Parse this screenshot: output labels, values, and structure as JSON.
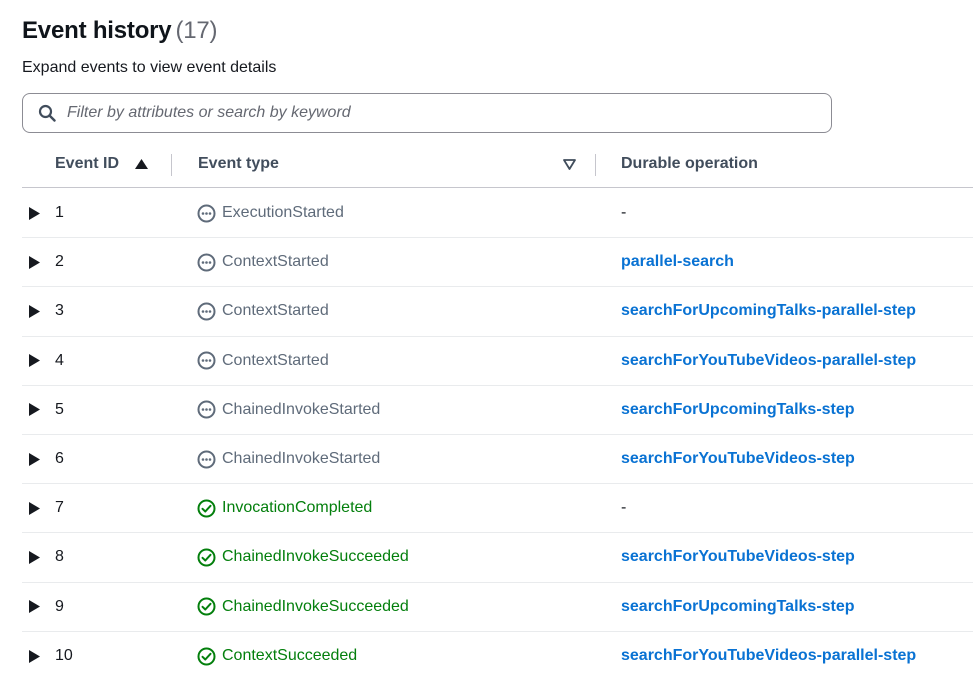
{
  "header": {
    "title": "Event history",
    "count": "(17)",
    "description": "Expand events to view event details"
  },
  "search": {
    "placeholder": "Filter by attributes or search by keyword",
    "value": ""
  },
  "columns": {
    "event_id": "Event ID",
    "event_type": "Event type",
    "durable_operation": "Durable operation"
  },
  "colors": {
    "link": "#0972d3",
    "success": "#037f0c",
    "pending": "#5f6b7a"
  },
  "rows": [
    {
      "id": "1",
      "type": "ExecutionStarted",
      "status": "pending",
      "operation": "-",
      "is_link": false
    },
    {
      "id": "2",
      "type": "ContextStarted",
      "status": "pending",
      "operation": "parallel-search",
      "is_link": true
    },
    {
      "id": "3",
      "type": "ContextStarted",
      "status": "pending",
      "operation": "searchForUpcomingTalks-parallel-step",
      "is_link": true
    },
    {
      "id": "4",
      "type": "ContextStarted",
      "status": "pending",
      "operation": "searchForYouTubeVideos-parallel-step",
      "is_link": true
    },
    {
      "id": "5",
      "type": "ChainedInvokeStarted",
      "status": "pending",
      "operation": "searchForUpcomingTalks-step",
      "is_link": true
    },
    {
      "id": "6",
      "type": "ChainedInvokeStarted",
      "status": "pending",
      "operation": "searchForYouTubeVideos-step",
      "is_link": true
    },
    {
      "id": "7",
      "type": "InvocationCompleted",
      "status": "success",
      "operation": "-",
      "is_link": false
    },
    {
      "id": "8",
      "type": "ChainedInvokeSucceeded",
      "status": "success",
      "operation": "searchForYouTubeVideos-step",
      "is_link": true
    },
    {
      "id": "9",
      "type": "ChainedInvokeSucceeded",
      "status": "success",
      "operation": "searchForUpcomingTalks-step",
      "is_link": true
    },
    {
      "id": "10",
      "type": "ContextSucceeded",
      "status": "success",
      "operation": "searchForYouTubeVideos-parallel-step",
      "is_link": true
    }
  ]
}
